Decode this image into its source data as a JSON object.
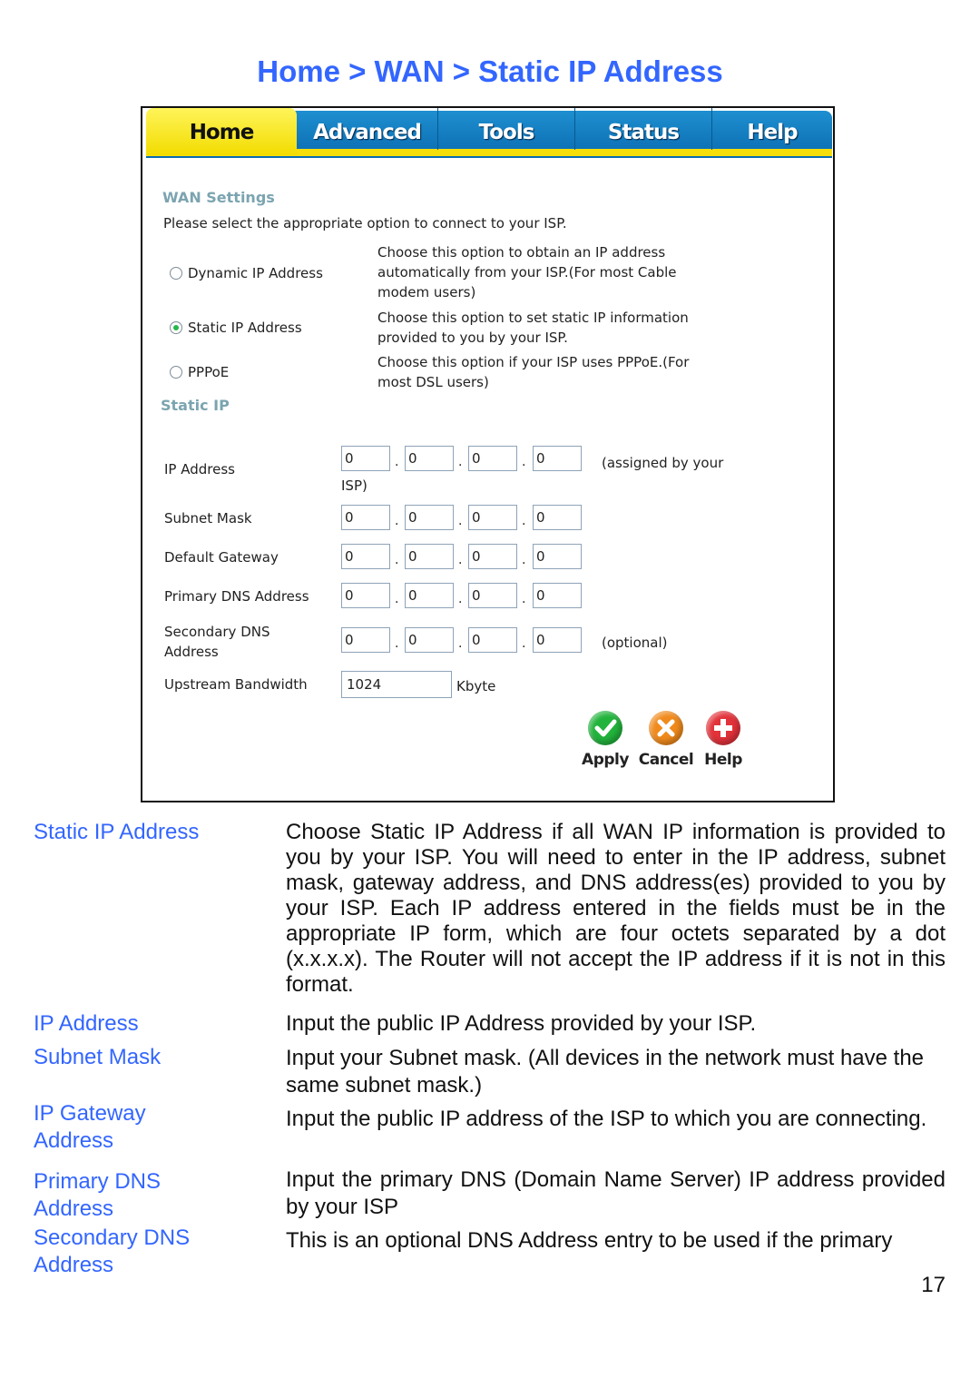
{
  "page_title": "Home > WAN > Static IP Address",
  "router_ui": {
    "tabs": [
      {
        "label": "Home",
        "active": true
      },
      {
        "label": "Advanced",
        "active": false
      },
      {
        "label": "Tools",
        "active": false
      },
      {
        "label": "Status",
        "active": false
      },
      {
        "label": "Help",
        "active": false
      }
    ],
    "wan_settings": {
      "heading": "WAN Settings",
      "instruction": "Please select the appropriate option to connect to your ISP.",
      "options": [
        {
          "label": "Dynamic IP Address",
          "selected": false,
          "description": [
            "Choose this option to obtain an IP address",
            "automatically from your ISP.(For most Cable",
            "modem users)"
          ]
        },
        {
          "label": "Static IP Address",
          "selected": true,
          "description": [
            "Choose this option to set static IP information",
            "provided to you by your ISP."
          ]
        },
        {
          "label": "PPPoE",
          "selected": false,
          "description": [
            "Choose this option if your ISP uses PPPoE.(For",
            "most DSL users)"
          ]
        }
      ]
    },
    "static_ip": {
      "heading": "Static IP",
      "fields": [
        {
          "label": "IP Address",
          "octets": [
            "0",
            "0",
            "0",
            "0"
          ],
          "note": "(assigned by your",
          "note_cont": "ISP)"
        },
        {
          "label": "Subnet Mask",
          "octets": [
            "0",
            "0",
            "0",
            "0"
          ]
        },
        {
          "label": "Default Gateway",
          "octets": [
            "0",
            "0",
            "0",
            "0"
          ]
        },
        {
          "label": "Primary DNS Address",
          "octets": [
            "0",
            "0",
            "0",
            "0"
          ]
        },
        {
          "label_line1": "Secondary DNS",
          "label_line2": "Address",
          "octets": [
            "0",
            "0",
            "0",
            "0"
          ],
          "note": "(optional)"
        }
      ],
      "dot": ".",
      "bandwidth": {
        "label": "Upstream Bandwidth",
        "value": "1024",
        "unit": "Kbyte"
      }
    },
    "actions": [
      {
        "label": "Apply",
        "icon": "check-icon"
      },
      {
        "label": "Cancel",
        "icon": "x-icon"
      },
      {
        "label": "Help",
        "icon": "plus-icon"
      }
    ]
  },
  "doc": [
    {
      "term": "Static IP Address",
      "text": "Choose Static IP Address if all WAN IP information is provided to you by your ISP. You will need to enter in the IP address, subnet mask, gateway address, and DNS address(es) provided to you by your ISP. Each IP address entered in the fields must be in the appropriate IP form, which are four octets separated by a dot (x.x.x.x). The Router will not accept the IP address if it is not in this format."
    },
    {
      "term": "IP Address",
      "text": "Input the public IP Address provided by your ISP."
    },
    {
      "term": "Subnet Mask",
      "text": "Input your Subnet mask. (All devices in the network must have the same subnet mask.)"
    },
    {
      "term": "IP Gateway Address",
      "text": "Input the public IP address of the ISP to which you are connecting."
    },
    {
      "term": "Primary DNS Address",
      "text": "Input the primary DNS (Domain Name Server) IP address provided by your ISP"
    },
    {
      "term": "Secondary DNS Address",
      "text": "This is an optional DNS Address entry to be used if the primary"
    }
  ],
  "page_number": "17"
}
